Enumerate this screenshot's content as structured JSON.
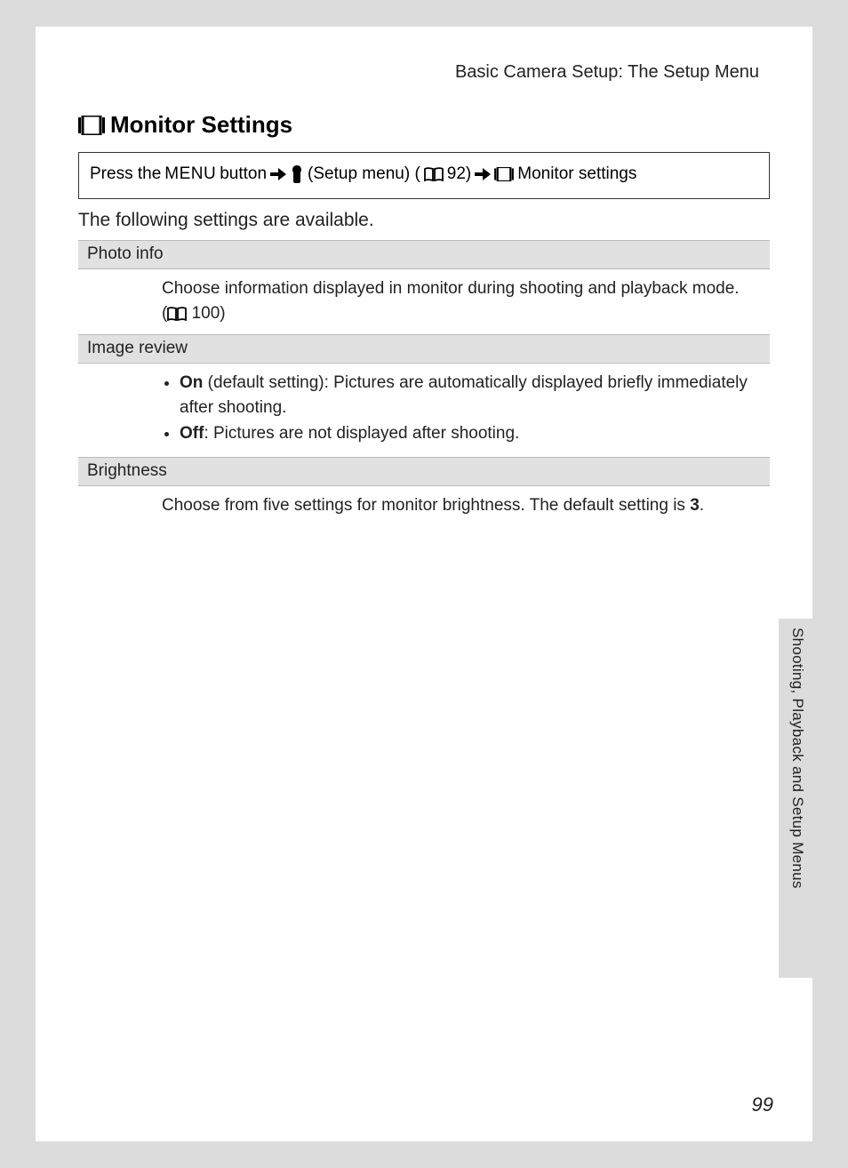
{
  "header": {
    "breadcrumb": "Basic Camera Setup: The Setup Menu"
  },
  "heading": {
    "icon": "monitor-icon",
    "text": "Monitor Settings"
  },
  "navbox": {
    "press_the": "Press the",
    "menu": "MENU",
    "button": "button",
    "setup_menu": "(Setup menu) (",
    "page_ref_1": "92)",
    "monitor_settings": "Monitor settings"
  },
  "intro": "The following settings are available.",
  "rows": {
    "photo_info": {
      "label": "Photo info",
      "body_line1": "Choose information displayed in monitor during shooting and playback mode.",
      "body_line2_prefix": "(",
      "body_line2_page": "100)"
    },
    "image_review": {
      "label": "Image review",
      "on_label": "On",
      "on_text": " (default setting): Pictures are automatically displayed briefly immediately after shooting.",
      "off_label": "Off",
      "off_text": ": Pictures are not displayed after shooting."
    },
    "brightness": {
      "label": "Brightness",
      "body_prefix": "Choose from five settings for monitor brightness. The default setting is ",
      "default_value": "3",
      "body_suffix": "."
    }
  },
  "side_label": "Shooting, Playback and Setup Menus",
  "page_number": "99"
}
